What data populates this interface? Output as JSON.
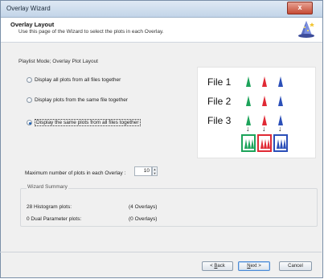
{
  "window": {
    "title": "Overlay Wizard",
    "close_glyph": "x"
  },
  "header": {
    "title": "Overlay Layout",
    "subtitle": "Use this page of the Wizard to select the plots in each Overlay.",
    "icon": "wizard-hat-icon"
  },
  "layout_group": {
    "label": "Playlist Mode; Overlay Plot Layout",
    "options": [
      {
        "label": "Display all plots from all files together",
        "checked": false
      },
      {
        "label": "Display plots from the same file together",
        "checked": false
      },
      {
        "label": "Display the same plots from all files together",
        "checked": true
      }
    ]
  },
  "diagram": {
    "files": [
      "File 1",
      "File 2",
      "File 3"
    ],
    "colors": {
      "green": "#1da35a",
      "red": "#e02a35",
      "blue": "#2b4fb8"
    }
  },
  "max_plots": {
    "label": "Maximum number of plots in each Overlay :",
    "value": "10"
  },
  "summary": {
    "title": "Wizard Summary",
    "rows": [
      {
        "label": "28 Histogram plots:",
        "value": "(4 Overlays)"
      },
      {
        "label": "0 Dual Parameter plots:",
        "value": "(0 Overlays)"
      }
    ]
  },
  "buttons": {
    "back": {
      "underlined": "B",
      "rest": "ack",
      "prefix": "< "
    },
    "next": {
      "underlined": "N",
      "rest": "ext >"
    },
    "cancel": "Cancel"
  }
}
